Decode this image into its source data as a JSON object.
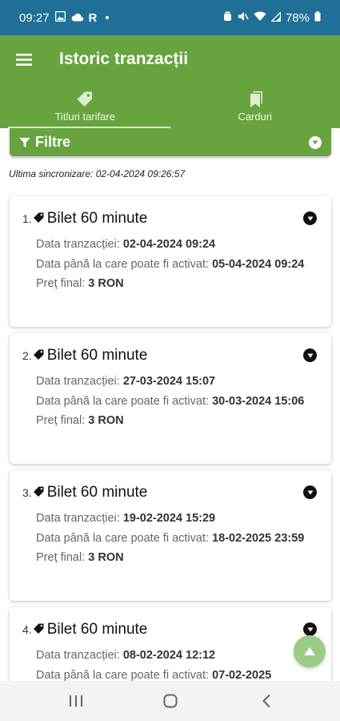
{
  "status": {
    "time": "09:27",
    "carrier_letter": "R",
    "battery": "78%"
  },
  "header": {
    "title": "Istoric tranzacții"
  },
  "tabs": [
    {
      "label": "Titluri tarifare",
      "icon": "tag-icon",
      "active": true
    },
    {
      "label": "Carduri",
      "icon": "bookmarks-icon",
      "active": false
    }
  ],
  "filter": {
    "label": "Filtre"
  },
  "sync": {
    "text": "Ultima sincronizare: 02-04-2024 09:26:57"
  },
  "labels": {
    "transaction_date": "Data tranzacției: ",
    "activation_date": "Data până la care poate fi activat: ",
    "final_price": "Preț final: "
  },
  "transactions": [
    {
      "number": "1.",
      "title": "Bilet 60 minute",
      "transaction_date": "02-04-2024 09:24",
      "activation_date": "05-04-2024 09:24",
      "price": "3 RON"
    },
    {
      "number": "2.",
      "title": "Bilet 60 minute",
      "transaction_date": "27-03-2024 15:07",
      "activation_date": "30-03-2024 15:06",
      "price": "3 RON"
    },
    {
      "number": "3.",
      "title": "Bilet 60 minute",
      "transaction_date": "19-02-2024 15:29",
      "activation_date": "18-02-2025 23:59",
      "price": "3 RON"
    },
    {
      "number": "4.",
      "title": "Bilet 60 minute",
      "transaction_date": "08-02-2024 12:12",
      "activation_date": "07-02-2025",
      "price": ""
    }
  ],
  "colors": {
    "primary": "#67a43f",
    "status_bar": "#1f6f97",
    "fab": "#9ccb86"
  }
}
